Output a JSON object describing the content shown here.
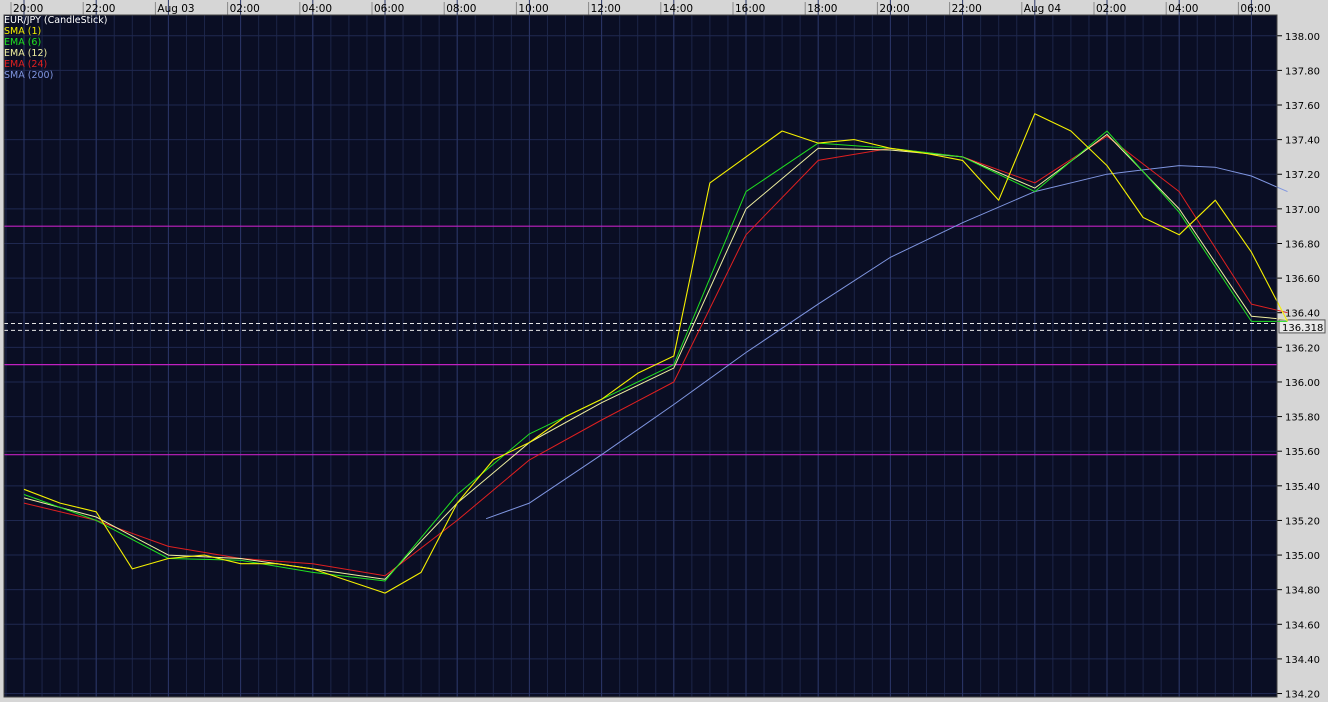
{
  "chart_data": {
    "type": "line",
    "symbol": "EUR/JPY (CandleStick)",
    "x_ticks": [
      "20:00",
      "22:00",
      "Aug 03",
      "02:00",
      "04:00",
      "06:00",
      "08:00",
      "10:00",
      "12:00",
      "14:00",
      "16:00",
      "18:00",
      "20:00",
      "22:00",
      "Aug 04",
      "02:00",
      "04:00",
      "06:00"
    ],
    "y_ticks": [
      "138.00",
      "137.80",
      "137.60",
      "137.40",
      "137.20",
      "137.00",
      "136.80",
      "136.60",
      "136.40",
      "136.20",
      "136.00",
      "135.80",
      "135.60",
      "135.40",
      "135.20",
      "135.00",
      "134.80",
      "134.60",
      "134.40",
      "134.20"
    ],
    "ylim": [
      134.18,
      138.12
    ],
    "current_price": "136.318",
    "horizontal_lines": [
      136.9,
      136.1,
      135.58
    ],
    "legend": [
      {
        "name": "EUR/JPY (CandleStick)",
        "color": "#ffffff"
      },
      {
        "name": "SMA (1)",
        "color": "#f5f000"
      },
      {
        "name": "EMA (6)",
        "color": "#20e020"
      },
      {
        "name": "EMA (12)",
        "color": "#f0f0a0"
      },
      {
        "name": "EMA (24)",
        "color": "#e02020"
      },
      {
        "name": "SMA (200)",
        "color": "#7f95e0"
      }
    ],
    "series": [
      {
        "key": "sma1",
        "color": "#f5f000",
        "x": [
          0,
          0.5,
          1,
          1.5,
          2,
          2.5,
          3,
          3.5,
          4,
          4.5,
          5,
          5.5,
          6,
          6.5,
          7,
          7.5,
          8,
          8.5,
          9,
          9.5,
          10,
          10.5,
          11,
          11.5,
          12,
          12.5,
          13,
          13.5,
          14,
          14.5,
          15,
          15.5,
          16,
          16.5,
          17,
          17.5
        ],
        "values": [
          135.38,
          135.3,
          135.25,
          134.92,
          134.98,
          135.0,
          134.95,
          134.95,
          134.92,
          134.85,
          134.78,
          134.9,
          135.3,
          135.55,
          135.65,
          135.8,
          135.9,
          136.05,
          136.15,
          137.15,
          137.3,
          137.45,
          137.38,
          137.4,
          137.35,
          137.32,
          137.28,
          137.05,
          137.55,
          137.45,
          137.25,
          136.95,
          136.85,
          137.05,
          136.75,
          136.35
        ]
      },
      {
        "key": "ema6",
        "color": "#20e020",
        "x": [
          0,
          1,
          2,
          3,
          4,
          5,
          6,
          7,
          8,
          9,
          10,
          11,
          12,
          13,
          14,
          15,
          16,
          17,
          17.5
        ],
        "values": [
          135.35,
          135.2,
          134.98,
          134.97,
          134.9,
          134.85,
          135.35,
          135.7,
          135.9,
          136.1,
          137.1,
          137.38,
          137.35,
          137.3,
          137.1,
          137.45,
          136.98,
          136.35,
          136.35
        ]
      },
      {
        "key": "ema12",
        "color": "#f0f0a0",
        "x": [
          0,
          1,
          2,
          3,
          4,
          5,
          6,
          7,
          8,
          9,
          10,
          11,
          12,
          13,
          14,
          15,
          16,
          17,
          17.5
        ],
        "values": [
          135.33,
          135.22,
          135.0,
          134.98,
          134.92,
          134.86,
          135.3,
          135.65,
          135.88,
          136.08,
          137.0,
          137.35,
          137.34,
          137.3,
          137.12,
          137.43,
          137.0,
          136.38,
          136.36
        ]
      },
      {
        "key": "ema24",
        "color": "#e02020",
        "x": [
          0,
          1,
          2,
          3,
          4,
          5,
          6,
          7,
          8,
          9,
          10,
          11,
          12,
          13,
          14,
          15,
          16,
          17,
          17.5
        ],
        "values": [
          135.3,
          135.2,
          135.05,
          134.98,
          134.95,
          134.88,
          135.2,
          135.55,
          135.78,
          136.0,
          136.85,
          137.28,
          137.35,
          137.3,
          137.15,
          137.42,
          137.1,
          136.45,
          136.4
        ]
      },
      {
        "key": "sma200",
        "color": "#7f95e0",
        "x": [
          6.4,
          7,
          8,
          9,
          10,
          11,
          12,
          13,
          14,
          15,
          16,
          16.5,
          17,
          17.5
        ],
        "values": [
          135.21,
          135.3,
          135.58,
          135.87,
          136.17,
          136.45,
          136.72,
          136.92,
          137.1,
          137.2,
          137.25,
          137.24,
          137.19,
          137.1
        ]
      }
    ]
  }
}
